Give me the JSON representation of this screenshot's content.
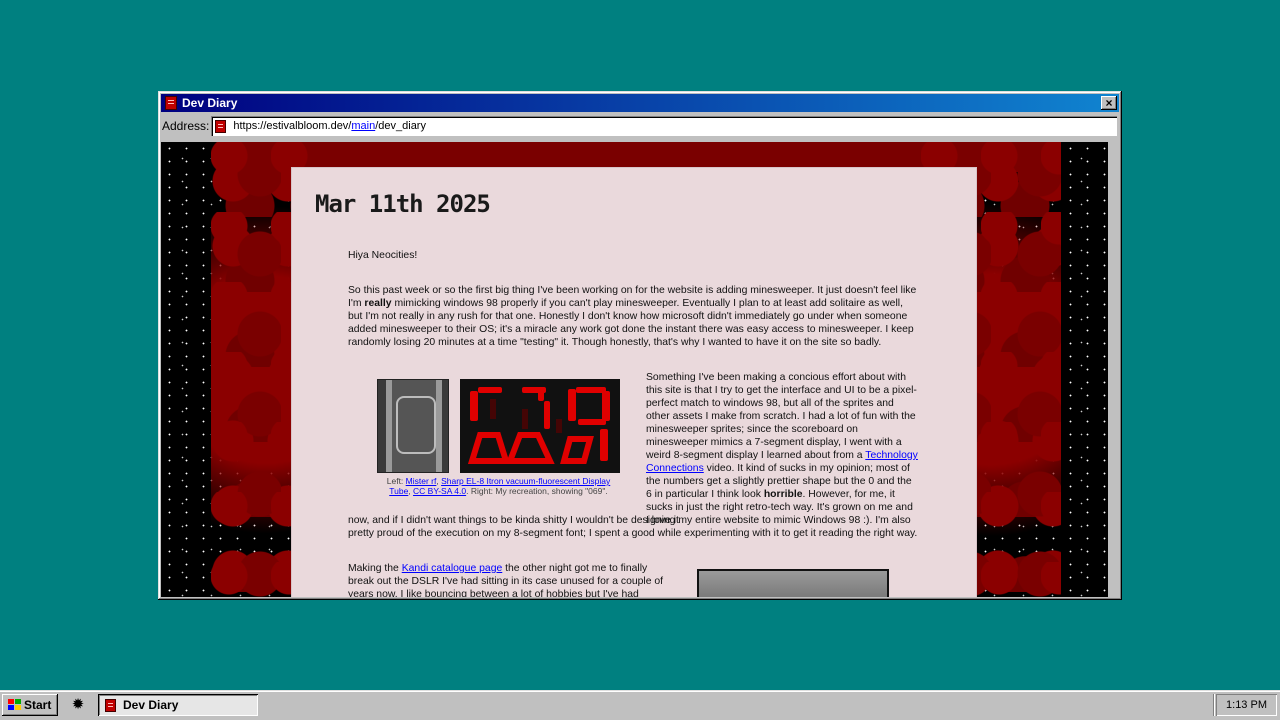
{
  "window": {
    "title": "Dev Diary",
    "address_label": "Address:",
    "url_prefix": "https://estivalbloom.dev/",
    "url_link": "main",
    "url_suffix": "/dev_diary",
    "close_glyph": "×"
  },
  "post": {
    "title": "Mar 11th 2025",
    "greeting": "Hiya Neocities!",
    "p2_a": "So this past week or so the first big thing I've been working on for the website is adding minesweeper. It just doesn't feel like I'm ",
    "p2_bold": "really",
    "p2_b": " mimicking windows 98 properly if you can't play minesweeper. Eventually I plan to at least add solitaire as well, but I'm not really in any rush for that one. Honestly I don't know how microsoft didn't immediately go under when someone added minesweeper to their OS; it's a miracle any work got done the instant there was easy access to minesweeper. I keep randomly losing 20 minutes at a time \"testing\" it. Though honestly, that's why I wanted to have it on the site so badly.",
    "p3_a": "Something I've been making a concious effort about with this site is that I try to get the interface and UI to be a pixel-perfect match to windows 98, but all of the sprites and other assets I make from scratch. I had a lot of fun with the minesweeper sprites; since the scoreboard on minesweeper mimics a 7-segment display, I went with a weird 8-segment display I learned about from a ",
    "p3_link": "Technology Connections",
    "p3_b": " video. It kind of sucks in my opinion; most of the numbers get a slightly prettier shape but the 0 and the 6 in particular I think look ",
    "p3_bold": "horrible",
    "p3_c": ". However, for me, it sucks in just the right retro-tech way. It's grown on me and I love it ",
    "p3_cont": "now, and if I didn't want things to be kinda shitty I wouldn't be designing my entire website to mimic Windows 98 :). I'm also pretty proud of the execution on my 8-segment font; I spent a good while experimenting with it to get it reading the right way.",
    "caption_left": "Left: ",
    "caption_link1": "Mister rf",
    "caption_comma": ", ",
    "caption_link2": "Sharp EL-8 Itron vacuum-fluorescent Display Tube",
    "caption_comma2": ", ",
    "caption_link3": "CC BY-SA 4.0",
    "caption_right": ". Right: My recreation, showing \"069\".",
    "p4_a": "Making the ",
    "p4_link": "Kandi catalogue page",
    "p4_b": " the other night got me to finally break out the DSLR I've had sitting in its case unused for a couple of years now. I like bouncing between a lot of hobbies but I've had trouble"
  },
  "taskbar": {
    "start_label": "Start",
    "task_label": "Dev Diary",
    "clock": "1:13 PM",
    "gear_glyph": "✹"
  },
  "colors": {
    "desktop": "#008080",
    "title_gradient_start": "#000080",
    "title_gradient_end": "#1084d0",
    "segment_red": "#e00000",
    "blood": "#8b0000"
  }
}
